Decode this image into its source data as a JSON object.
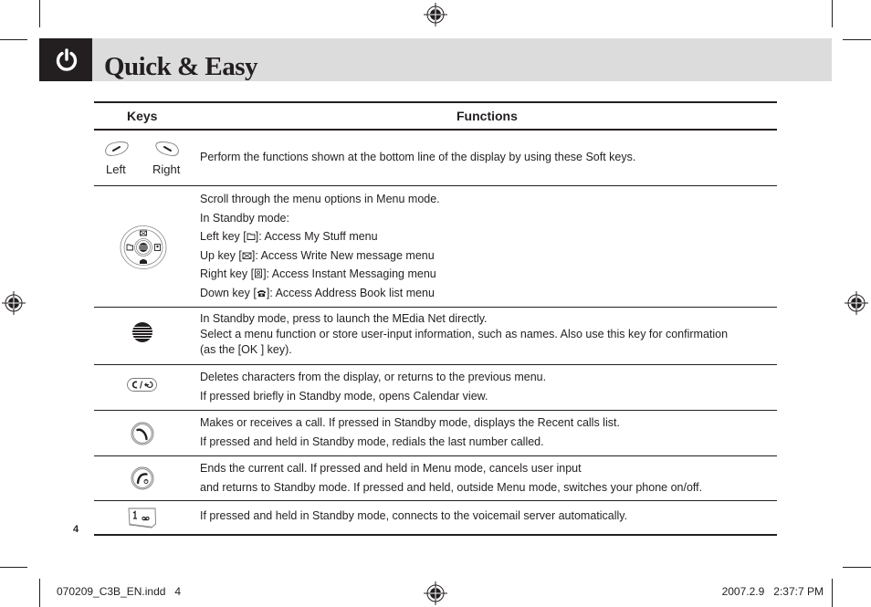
{
  "header": {
    "title": "Quick & Easy",
    "icon": "power-icon",
    "band_color": "#dcdcdc",
    "icon_box_color": "#231f20"
  },
  "table": {
    "headers": {
      "keys": "Keys",
      "functions": "Functions"
    },
    "rows": [
      {
        "key_icon": "soft-keys-icon",
        "key_labels": [
          "Left",
          "Right"
        ],
        "functions": [
          "Perform the functions shown at the bottom line of the display by using these Soft keys."
        ]
      },
      {
        "key_icon": "navigation-key-icon",
        "functions": [
          "Scroll through the menu options in Menu mode.",
          "In Standby mode:",
          {
            "prefix": "Left key [",
            "icon": "folder-icon",
            "suffix": "]: Access My Stuff menu"
          },
          {
            "prefix": "Up key [",
            "icon": "envelope-icon",
            "suffix": "]: Access Write New message menu"
          },
          {
            "prefix": "Right key [",
            "icon": "contact-card-icon",
            "suffix": "]: Access Instant Messaging menu"
          },
          {
            "prefix": "Down key [",
            "icon": "phone-book-icon",
            "suffix": "]: Access Address Book list menu"
          }
        ]
      },
      {
        "key_icon": "att-globe-key-icon",
        "functions": [
          "In Standby mode, press to launch the MEdia Net directly.",
          "Select a menu function or store user-input information, such as names. Also use this key for confirmation",
          "(as the [OK ] key)."
        ]
      },
      {
        "key_icon": "clear-back-key-icon",
        "key_text": "C / ↩",
        "functions": [
          "Deletes characters from the display, or returns to the previous menu.",
          "If pressed briefly in Standby mode, opens Calendar view."
        ]
      },
      {
        "key_icon": "send-call-key-icon",
        "functions": [
          "Makes or receives a call. If pressed in Standby mode, displays the Recent calls list.",
          "If pressed and held in Standby mode, redials the last number called."
        ]
      },
      {
        "key_icon": "end-power-key-icon",
        "functions": [
          "Ends the current call. If pressed and held in Menu mode, cancels user input",
          "and returns to Standby mode. If pressed and held, outside Menu mode, switches your phone on/off."
        ]
      },
      {
        "key_icon": "voicemail-key-1-icon",
        "key_text": "1",
        "functions": [
          "If pressed and held in Standby mode, connects to the voicemail server automatically."
        ]
      }
    ]
  },
  "page_number": "4",
  "footer": {
    "left": "070209_C3B_EN.indd   4",
    "right": "2007.2.9   2:37:7 PM"
  }
}
